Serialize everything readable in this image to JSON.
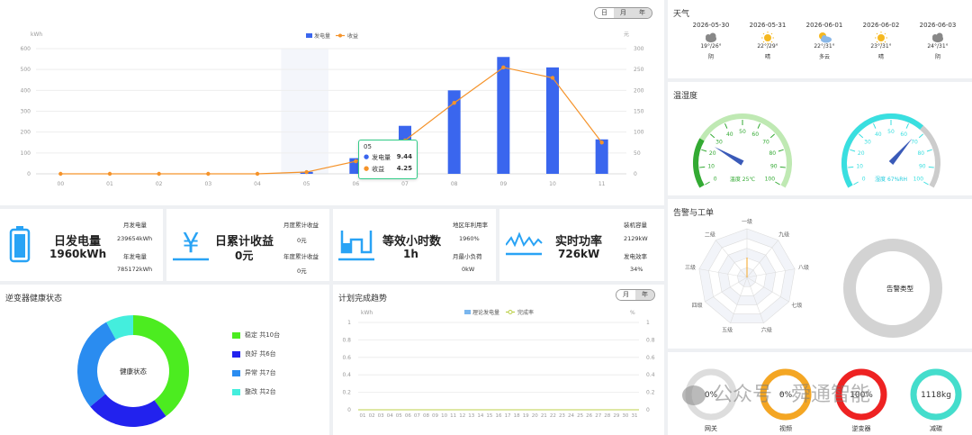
{
  "top_chart": {
    "seg": [
      "日",
      "月",
      "年"
    ],
    "unit_left": "kWh",
    "unit_right": "元",
    "legend": [
      "发电量",
      "收益"
    ],
    "tooltip": {
      "title": "05",
      "rows": [
        {
          "name": "发电量",
          "value": "9.44"
        },
        {
          "name": "收益",
          "value": "4.25"
        }
      ]
    }
  },
  "chart_data": {
    "type": "bar",
    "categories": [
      "00",
      "01",
      "02",
      "03",
      "04",
      "05",
      "06",
      "07",
      "08",
      "09",
      "10",
      "11"
    ],
    "series": [
      {
        "name": "发电量",
        "values": [
          0,
          0,
          0,
          0,
          0,
          9.44,
          75,
          230,
          400,
          560,
          510,
          165
        ]
      },
      {
        "name": "收益",
        "values": [
          0,
          0,
          0,
          0,
          0,
          4.25,
          30,
          80,
          170,
          255,
          230,
          75
        ]
      }
    ],
    "ylim": [
      0,
      600
    ],
    "y2lim": [
      0,
      300
    ],
    "yticks": [
      "0",
      "100",
      "200",
      "300",
      "400",
      "500",
      "600"
    ],
    "y2ticks": [
      "0",
      "50",
      "100",
      "150",
      "200",
      "250",
      "300"
    ]
  },
  "weather": {
    "title": "天气",
    "days": [
      {
        "date": "2026-05-30",
        "temp": "19°/26°",
        "desc": "阴",
        "icon": "cloud-icon"
      },
      {
        "date": "2026-05-31",
        "temp": "22°/29°",
        "desc": "晴",
        "icon": "sun-icon"
      },
      {
        "date": "2026-06-01",
        "temp": "22°/31°",
        "desc": "多云",
        "icon": "partly-cloudy-icon"
      },
      {
        "date": "2026-06-02",
        "temp": "23°/31°",
        "desc": "晴",
        "icon": "sun-icon"
      },
      {
        "date": "2026-06-03",
        "temp": "24°/31°",
        "desc": "阴",
        "icon": "cloud-icon"
      }
    ]
  },
  "humidity": {
    "title": "温湿度",
    "temp_label": "温度 25℃",
    "hum_label": "湿度 67%RH",
    "temp_value": 25,
    "hum_value": 67
  },
  "stats": {
    "daily": {
      "title": "日发电量",
      "value": "1960kWh",
      "l1": "月发电量",
      "v1": "239654kWh",
      "l2": "年发电量",
      "v2": "785172kWh"
    },
    "income": {
      "title": "日累计收益",
      "value": "0元",
      "l1": "月度累计收益",
      "v1": "0元",
      "l2": "年度累计收益",
      "v2": "0元"
    },
    "hours": {
      "title": "等效小时数",
      "value": "1h",
      "l1": "地区年利用率",
      "v1": "1960%",
      "l2": "月最小负荷",
      "v2": "0kW"
    },
    "power": {
      "title": "实时功率",
      "value": "726kW",
      "l1": "装机容量",
      "v1": "2129kW",
      "l2": "发电效率",
      "v2": "34%"
    }
  },
  "alarm": {
    "title": "告警与工单",
    "radar_labels": [
      "一级",
      "九级",
      "八级",
      "七级",
      "六级",
      "五级",
      "四级",
      "三级",
      "二级"
    ],
    "donut_label": "告警类型"
  },
  "health": {
    "title": "逆变器健康状态",
    "center": "健康状态",
    "items": [
      {
        "label": "稳定 共10台",
        "count": 10,
        "color": "#4cec20"
      },
      {
        "label": "良好 共6台",
        "count": 6,
        "color": "#2222ee"
      },
      {
        "label": "异常 共7台",
        "count": 7,
        "color": "#2a8cf0"
      },
      {
        "label": "整改 共2台",
        "count": 2,
        "color": "#44eedd"
      }
    ]
  },
  "plan": {
    "title": "计划完成趋势",
    "seg": [
      "月",
      "年"
    ],
    "unit_left": "kWh",
    "unit_right": "%",
    "legend": [
      "理论发电量",
      "完成率"
    ],
    "yticks": [
      "0",
      "0.2",
      "0.4",
      "0.6",
      "0.8",
      "1"
    ],
    "xticks": [
      "01",
      "02",
      "03",
      "04",
      "05",
      "06",
      "07",
      "08",
      "09",
      "10",
      "11",
      "12",
      "13",
      "14",
      "15",
      "16",
      "17",
      "18",
      "19",
      "20",
      "21",
      "22",
      "23",
      "24",
      "25",
      "26",
      "27",
      "28",
      "29",
      "30",
      "31"
    ]
  },
  "devices": {
    "items": [
      {
        "value": "0%",
        "label": "网关",
        "color": "#dddddd"
      },
      {
        "value": "0%",
        "label": "视频",
        "color": "#f4a623"
      },
      {
        "value": "100%",
        "label": "逆变器",
        "color": "#ee2222"
      },
      {
        "value": "1118kg",
        "label": "减碳",
        "color": "#44ddcc"
      }
    ]
  },
  "watermark": "公众号 · 舜通智能"
}
